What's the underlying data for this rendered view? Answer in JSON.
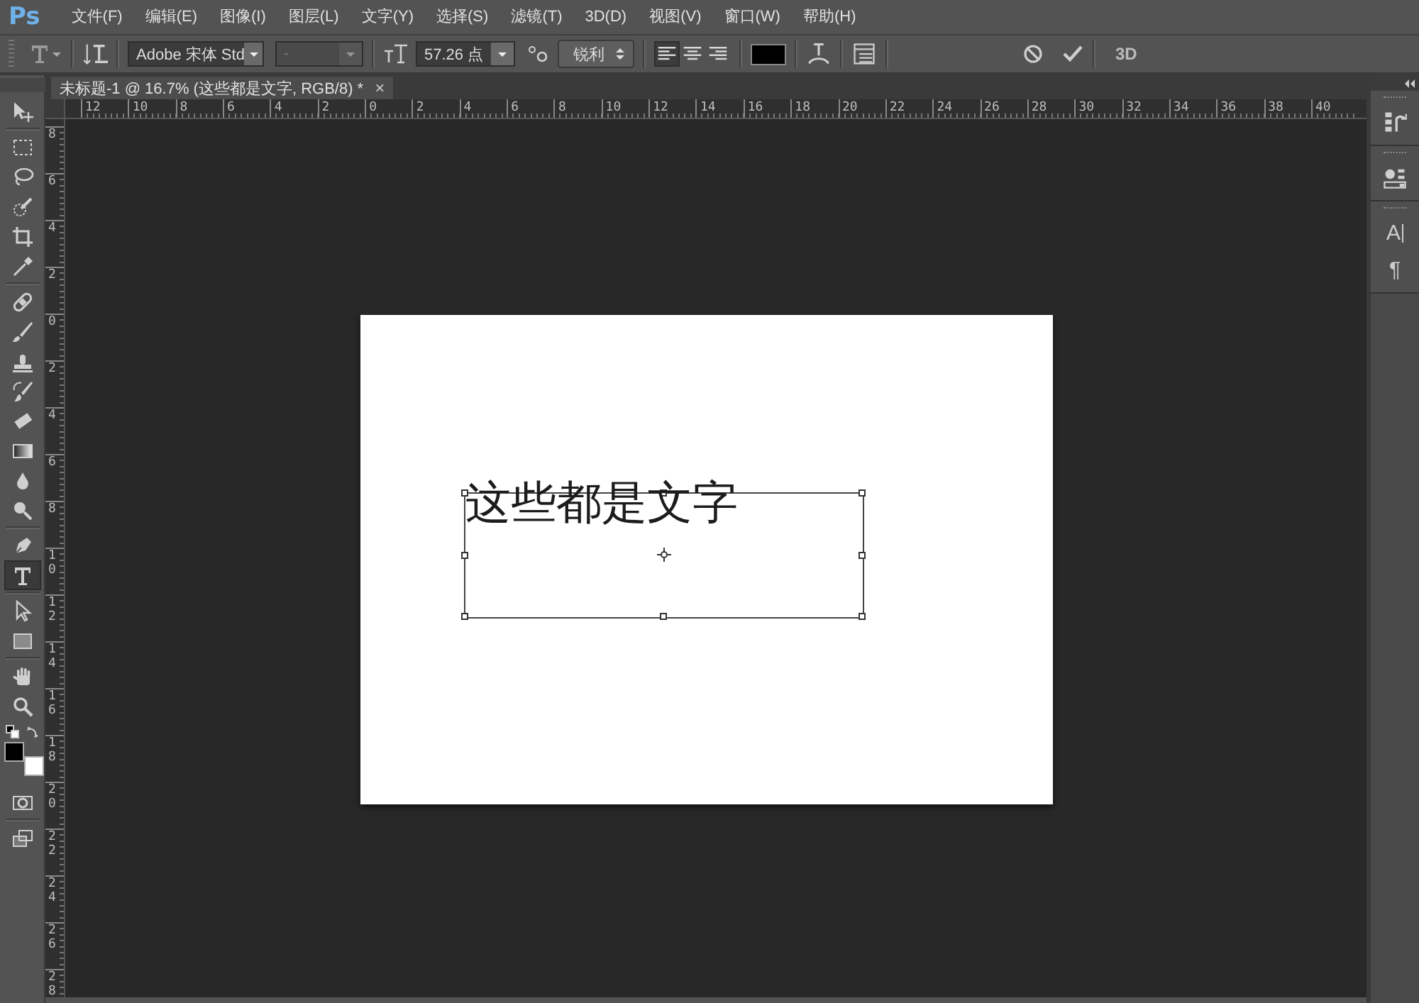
{
  "app_logo": "Ps",
  "menu": [
    {
      "label": "文件(F)"
    },
    {
      "label": "编辑(E)"
    },
    {
      "label": "图像(I)"
    },
    {
      "label": "图层(L)"
    },
    {
      "label": "文字(Y)"
    },
    {
      "label": "选择(S)"
    },
    {
      "label": "滤镜(T)"
    },
    {
      "label": "3D(D)"
    },
    {
      "label": "视图(V)"
    },
    {
      "label": "窗口(W)"
    },
    {
      "label": "帮助(H)"
    }
  ],
  "options_bar": {
    "font_family": "Adobe 宋体 Std",
    "font_style": {
      "value": "-",
      "disabled": true
    },
    "font_size": "57.26 点",
    "anti_alias": "锐利",
    "alignment": [
      {
        "kind": "left",
        "selected": true
      },
      {
        "kind": "center",
        "selected": false
      },
      {
        "kind": "right",
        "selected": false
      }
    ],
    "text_color_swatch": {
      "color": "#000000"
    },
    "three_d": "3D"
  },
  "document_tab": {
    "title": "未标题-1 @ 16.7% (这些都是文字, RGB/8) *",
    "close": "×"
  },
  "top_ruler": [
    "12",
    "10",
    "8",
    "6",
    "4",
    "2",
    "0",
    "2",
    "4",
    "6",
    "8",
    "10",
    "12",
    "14",
    "16",
    "18",
    "20",
    "22",
    "24",
    "26",
    "28",
    "30",
    "32",
    "34",
    "36",
    "38",
    "40"
  ],
  "left_ruler": [
    "8",
    "6",
    "4",
    "2",
    "0",
    "2",
    "4",
    "6",
    "8",
    "10",
    "12",
    "14",
    "16",
    "18",
    "20",
    "22",
    "24",
    "26",
    "28"
  ],
  "tools": [
    {
      "kind": "move",
      "selected": false
    },
    {
      "kind": "marquee",
      "selected": false
    },
    {
      "kind": "lasso",
      "selected": false
    },
    {
      "kind": "quick-select",
      "selected": false
    },
    {
      "kind": "crop",
      "selected": false
    },
    {
      "kind": "eyedropper",
      "selected": false
    },
    {
      "kind": "healing",
      "selected": false
    },
    {
      "kind": "brush",
      "selected": false
    },
    {
      "kind": "stamp",
      "selected": false
    },
    {
      "kind": "history-brush",
      "selected": false
    },
    {
      "kind": "eraser",
      "selected": false
    },
    {
      "kind": "gradient",
      "selected": false
    },
    {
      "kind": "blur",
      "selected": false
    },
    {
      "kind": "dodge",
      "selected": false
    },
    {
      "kind": "pen",
      "selected": false
    },
    {
      "kind": "type",
      "selected": true
    },
    {
      "kind": "path-select",
      "selected": false
    },
    {
      "kind": "rectangle",
      "selected": false
    },
    {
      "kind": "hand",
      "selected": false
    },
    {
      "kind": "zoom",
      "selected": false
    }
  ],
  "color_swatches": [
    {
      "kind": "foreground",
      "color": "#000000"
    },
    {
      "kind": "background",
      "color": "#ffffff"
    }
  ],
  "mode_tools": [
    {
      "kind": "quick-mask"
    },
    {
      "kind": "screen-mode"
    }
  ],
  "document": {
    "text": "这些都是文字"
  },
  "panel_dock": [
    {
      "items": [
        {
          "kind": "history"
        }
      ]
    },
    {
      "items": [
        {
          "kind": "properties"
        }
      ]
    },
    {
      "items": [
        {
          "kind": "character",
          "glyph": "A"
        },
        {
          "kind": "paragraph",
          "glyph": "¶"
        }
      ]
    }
  ]
}
